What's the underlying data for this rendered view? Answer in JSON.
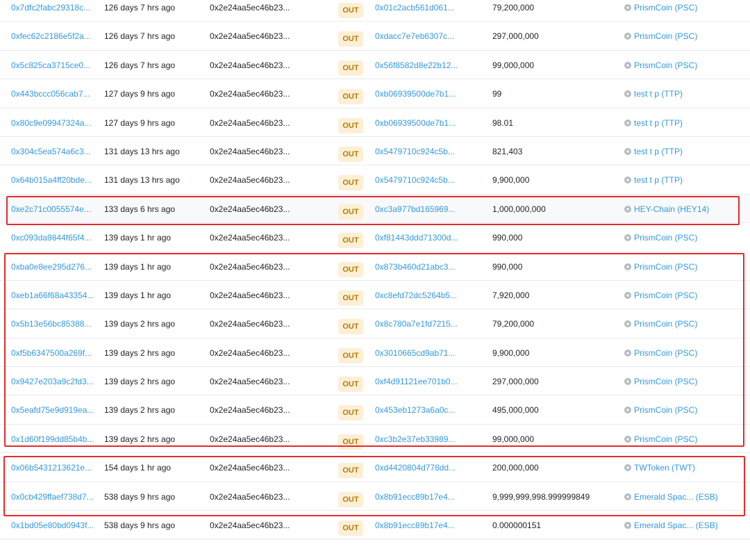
{
  "direction_label": "OUT",
  "colors": {
    "link": "#3498db",
    "out_badge_bg": "#fcefd6",
    "out_badge_text": "#b47d00",
    "highlight_box": "#e32b2b"
  },
  "rows": [
    {
      "hash": "0x7dfc2fabc29318c...",
      "age": "126 days 7 hrs ago",
      "from": "0x2e24aa5ec46b23...",
      "to": "0x01c2acb561d061...",
      "value": "79,200,000",
      "token": "PrismCoin (PSC)"
    },
    {
      "hash": "0xfec62c2186e5f2a...",
      "age": "126 days 7 hrs ago",
      "from": "0x2e24aa5ec46b23...",
      "to": "0xdacc7e7eb6307c...",
      "value": "297,000,000",
      "token": "PrismCoin (PSC)"
    },
    {
      "hash": "0x5c825ca3715ce0...",
      "age": "126 days 7 hrs ago",
      "from": "0x2e24aa5ec46b23...",
      "to": "0x56f8582d8e22b12...",
      "value": "99,000,000",
      "token": "PrismCoin (PSC)"
    },
    {
      "hash": "0x443bccc056cab7...",
      "age": "127 days 9 hrs ago",
      "from": "0x2e24aa5ec46b23...",
      "to": "0xb06939500de7b1...",
      "value": "99",
      "token": "test t p (TTP)"
    },
    {
      "hash": "0x80c9e09947324a...",
      "age": "127 days 9 hrs ago",
      "from": "0x2e24aa5ec46b23...",
      "to": "0xb06939500de7b1...",
      "value": "98.01",
      "token": "test t p (TTP)"
    },
    {
      "hash": "0x304c5ea574a6c3...",
      "age": "131 days 13 hrs ago",
      "from": "0x2e24aa5ec46b23...",
      "to": "0x5479710c924c5b...",
      "value": "821,403",
      "token": "test t p (TTP)"
    },
    {
      "hash": "0x64b015a4ff20bde...",
      "age": "131 days 13 hrs ago",
      "from": "0x2e24aa5ec46b23...",
      "to": "0x5479710c924c5b...",
      "value": "9,900,000",
      "token": "test t p (TTP)"
    },
    {
      "hash": "0xe2c71c0055574e...",
      "age": "133 days 6 hrs ago",
      "from": "0x2e24aa5ec46b23...",
      "to": "0xc3a977bd165969...",
      "value": "1,000,000,000",
      "token": "HEY-Chain (HEY14)"
    },
    {
      "hash": "0xc093da9844f65f4...",
      "age": "139 days 1 hr ago",
      "from": "0x2e24aa5ec46b23...",
      "to": "0xf81443ddd71300d...",
      "value": "990,000",
      "token": "PrismCoin (PSC)"
    },
    {
      "hash": "0xba0e8ee295d276...",
      "age": "139 days 1 hr ago",
      "from": "0x2e24aa5ec46b23...",
      "to": "0x873b460d21abc3...",
      "value": "990,000",
      "token": "PrismCoin (PSC)"
    },
    {
      "hash": "0xeb1a66f68a43354...",
      "age": "139 days 1 hr ago",
      "from": "0x2e24aa5ec46b23...",
      "to": "0xc8efd72dc5264b5...",
      "value": "7,920,000",
      "token": "PrismCoin (PSC)"
    },
    {
      "hash": "0x5b13e56bc85388...",
      "age": "139 days 2 hrs ago",
      "from": "0x2e24aa5ec46b23...",
      "to": "0x8c780a7e1fd7215...",
      "value": "79,200,000",
      "token": "PrismCoin (PSC)"
    },
    {
      "hash": "0xf5b6347500a269f...",
      "age": "139 days 2 hrs ago",
      "from": "0x2e24aa5ec46b23...",
      "to": "0x3010665cd9ab71...",
      "value": "9,900,000",
      "token": "PrismCoin (PSC)"
    },
    {
      "hash": "0x9427e203a9c2fd3...",
      "age": "139 days 2 hrs ago",
      "from": "0x2e24aa5ec46b23...",
      "to": "0xf4d91121ee701b0...",
      "value": "297,000,000",
      "token": "PrismCoin (PSC)"
    },
    {
      "hash": "0x5eafd75e9d919ea...",
      "age": "139 days 2 hrs ago",
      "from": "0x2e24aa5ec46b23...",
      "to": "0x453eb1273a6a0c...",
      "value": "495,000,000",
      "token": "PrismCoin (PSC)"
    },
    {
      "hash": "0x1d60f199dd85b4b...",
      "age": "139 days 2 hrs ago",
      "from": "0x2e24aa5ec46b23...",
      "to": "0xc3b2e37eb33989...",
      "value": "99,000,000",
      "token": "PrismCoin (PSC)"
    },
    {
      "hash": "0x06b5431213621e...",
      "age": "154 days 1 hr ago",
      "from": "0x2e24aa5ec46b23...",
      "to": "0xd4420804d778dd...",
      "value": "200,000,000",
      "token": "TWToken (TWT)"
    },
    {
      "hash": "0x0cb429ffaef738d7...",
      "age": "538 days 9 hrs ago",
      "from": "0x2e24aa5ec46b23...",
      "to": "0x8b91ecc89b17e4...",
      "value": "9,999,999,998.999999849",
      "token": "Emerald Spac... (ESB)"
    },
    {
      "hash": "0x1bd05e80bd0943f...",
      "age": "538 days 9 hrs ago",
      "from": "0x2e24aa5ec46b23...",
      "to": "0x8b91ecc89b17e4...",
      "value": "0.000000151",
      "token": "Emerald Spac... (ESB)"
    }
  ]
}
